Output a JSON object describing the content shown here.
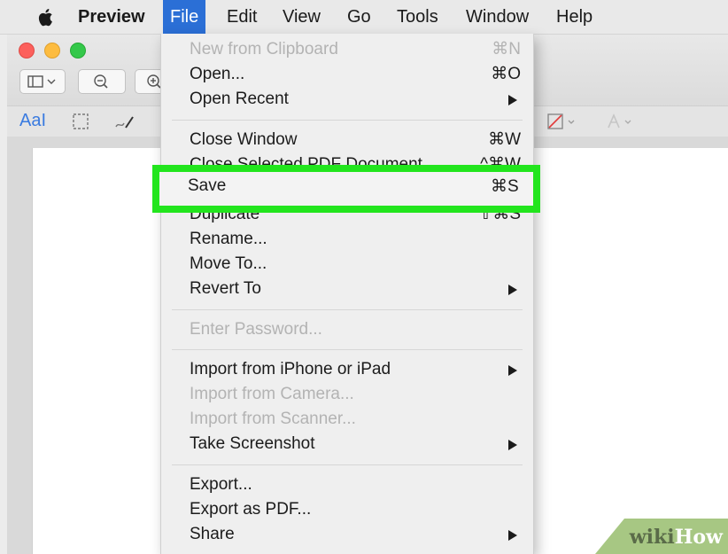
{
  "menubar": {
    "items": [
      "Preview",
      "File",
      "Edit",
      "View",
      "Go",
      "Tools",
      "Window",
      "Help"
    ]
  },
  "toolbar": {
    "markup_text": "AaI"
  },
  "file_menu": {
    "items": [
      {
        "label": "New from Clipboard",
        "shortcut": "⌘N",
        "disabled": true
      },
      {
        "label": "Open...",
        "shortcut": "⌘O"
      },
      {
        "label": "Open Recent",
        "submenu": true
      },
      {
        "label": "Close Window",
        "shortcut": "⌘W"
      },
      {
        "label": "Close Selected PDF Document",
        "shortcut": "^⌘W"
      },
      {
        "label": "Save",
        "shortcut": "⌘S",
        "highlighted": true
      },
      {
        "label": "Duplicate",
        "shortcut": "⇧⌘S"
      },
      {
        "label": "Rename..."
      },
      {
        "label": "Move To..."
      },
      {
        "label": "Revert To",
        "submenu": true
      },
      {
        "label": "Enter Password...",
        "disabled": true
      },
      {
        "label": "Import from iPhone or iPad",
        "submenu": true
      },
      {
        "label": "Import from Camera...",
        "disabled": true
      },
      {
        "label": "Import from Scanner...",
        "disabled": true
      },
      {
        "label": "Take Screenshot",
        "submenu": true
      },
      {
        "label": "Export..."
      },
      {
        "label": "Export as PDF..."
      },
      {
        "label": "Share",
        "submenu": true
      }
    ]
  },
  "watermark": {
    "part1": "wiki",
    "part2": "How"
  },
  "colors": {
    "highlight": "#22e51d",
    "menu_active": "#2b6fd6"
  }
}
